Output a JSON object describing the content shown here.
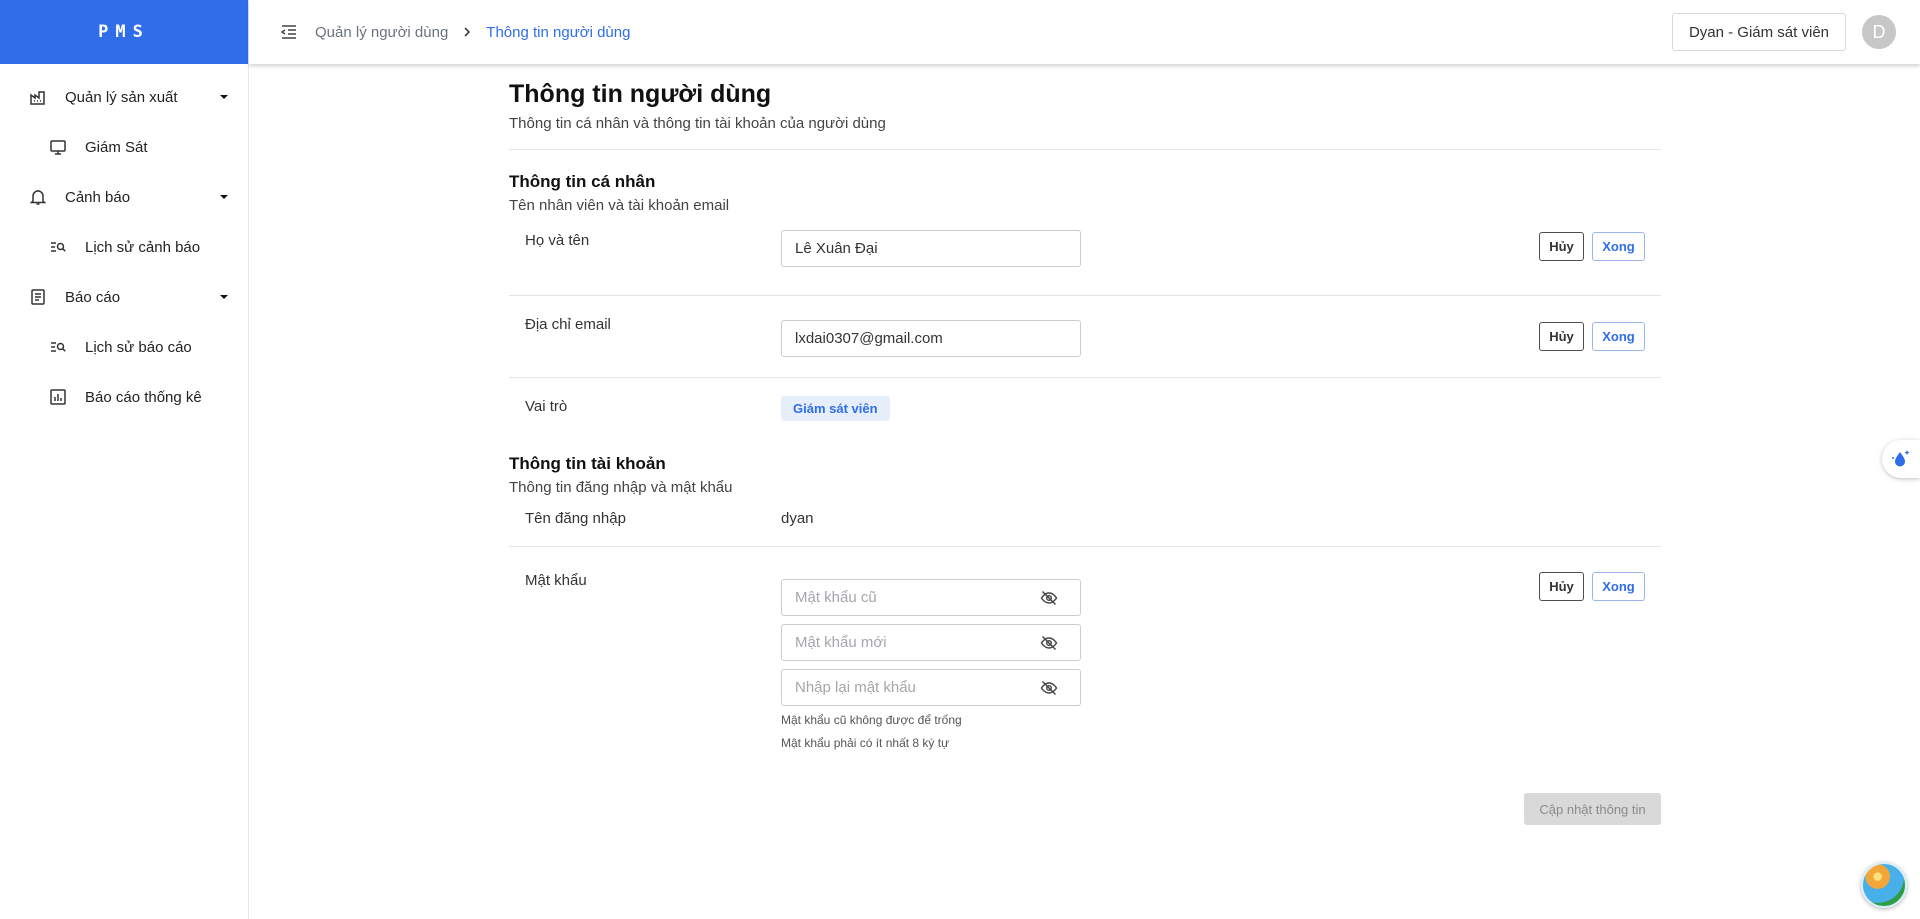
{
  "app": {
    "logo": "PMS"
  },
  "sidebar": {
    "groups": [
      {
        "label": "Quản lý sản xuất",
        "icon": "factory-icon",
        "items": [
          {
            "label": "Giám Sát",
            "icon": "monitor-icon"
          }
        ]
      },
      {
        "label": "Cảnh báo",
        "icon": "bell-icon",
        "items": [
          {
            "label": "Lịch sử cảnh báo",
            "icon": "list-search-icon"
          }
        ]
      },
      {
        "label": "Báo cáo",
        "icon": "document-icon",
        "items": [
          {
            "label": "Lịch sử báo cáo",
            "icon": "list-search-icon"
          },
          {
            "label": "Báo cáo thống kê",
            "icon": "bar-chart-icon"
          }
        ]
      }
    ]
  },
  "header": {
    "breadcrumb": [
      "Quản lý người dùng",
      "Thông tin người dùng"
    ],
    "user_label": "Dyan - Giám sát viên",
    "avatar_letter": "D"
  },
  "page": {
    "title": "Thông tin người dùng",
    "subtitle": "Thông tin cá nhân và thông tin tài khoản của người dùng"
  },
  "personal": {
    "title": "Thông tin cá nhân",
    "subtitle": "Tên nhân viên và tài khoản email",
    "name_label": "Họ và tên",
    "name_value": "Lê Xuân Đại",
    "email_label": "Địa chỉ email",
    "email_value": "lxdai0307@gmail.com",
    "role_label": "Vai trò",
    "role_value": "Giám sát viên"
  },
  "account": {
    "title": "Thông tin tài khoản",
    "subtitle": "Thông tin đăng nhập và mật khẩu",
    "username_label": "Tên đăng nhập",
    "username_value": "dyan",
    "password_label": "Mật khẩu",
    "old_password_placeholder": "Mật khẩu cũ",
    "new_password_placeholder": "Mật khẩu mới",
    "confirm_password_placeholder": "Nhập lại mật khẩu",
    "hint_1": "Mật khẩu cũ không được để trống",
    "hint_2": "Mật khẩu phải có ít nhất 8 ký tự"
  },
  "buttons": {
    "cancel": "Hủy",
    "done": "Xong",
    "update": "Cập nhật thông tin"
  },
  "colors": {
    "primary": "#2f6ee8",
    "badge_bg": "#e6edfb",
    "disabled_bg": "#d9d9d9"
  }
}
